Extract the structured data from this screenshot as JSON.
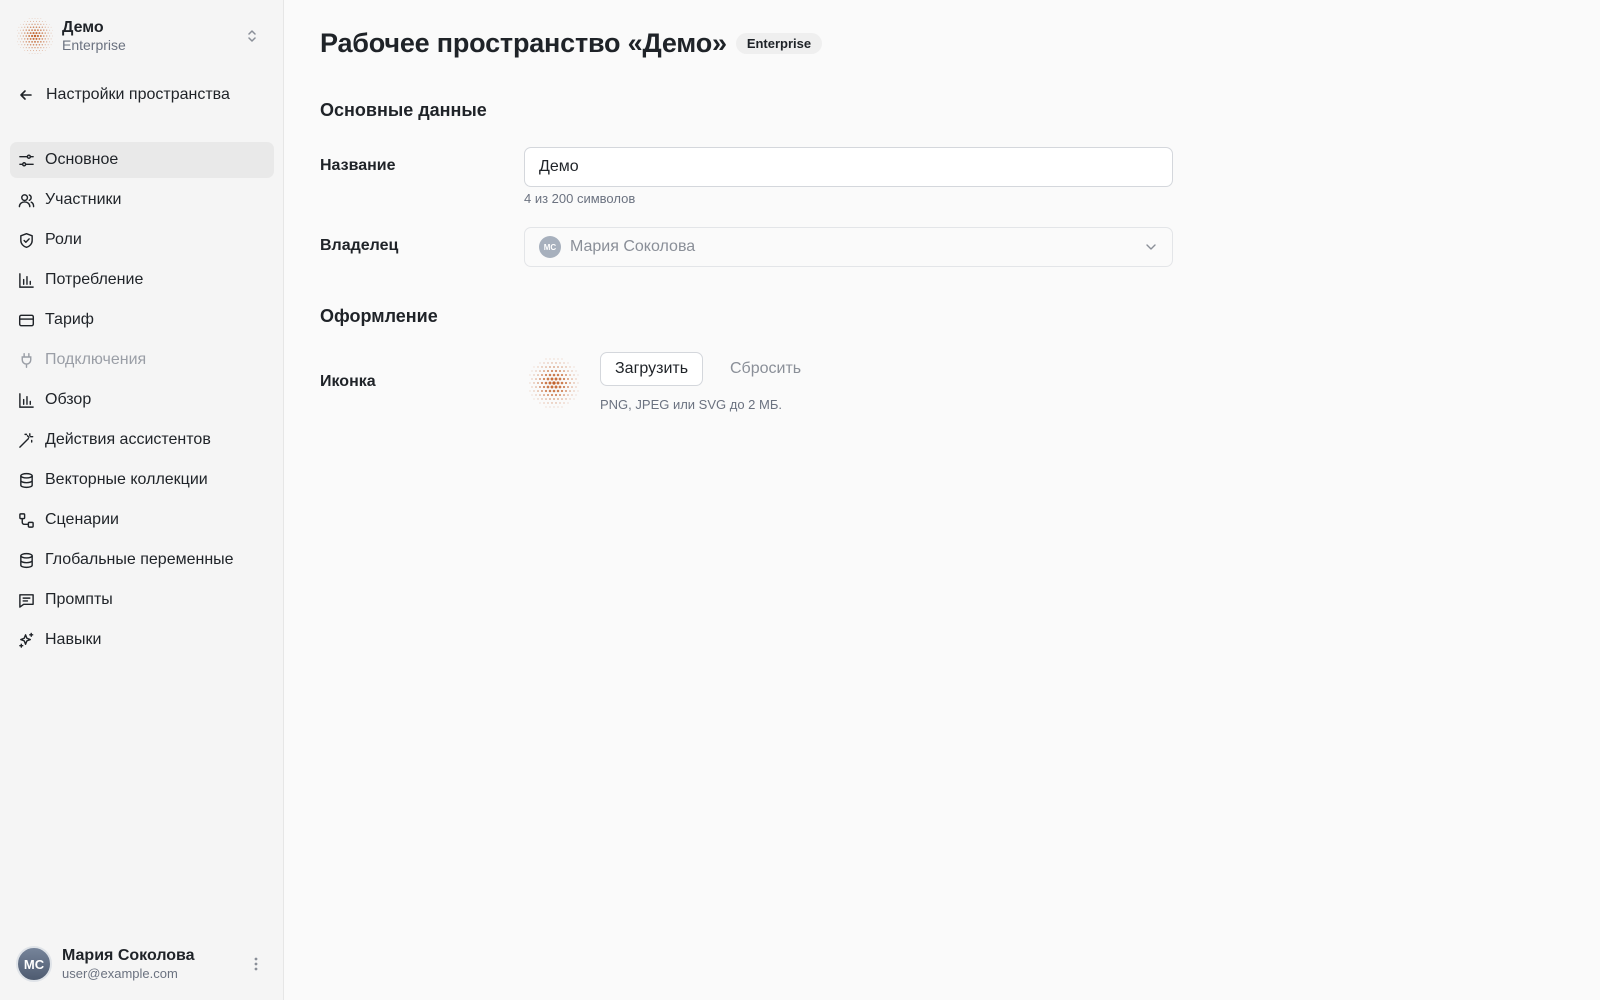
{
  "workspace": {
    "name": "Демо",
    "plan": "Enterprise"
  },
  "sidebar": {
    "back_label": "Настройки пространства",
    "items": [
      {
        "label": "Основное",
        "icon": "sliders-icon",
        "active": true
      },
      {
        "label": "Участники",
        "icon": "users-icon"
      },
      {
        "label": "Роли",
        "icon": "shield-icon"
      },
      {
        "label": "Потребление",
        "icon": "bar-chart-icon"
      },
      {
        "label": "Тариф",
        "icon": "credit-card-icon"
      },
      {
        "label": "Подключения",
        "icon": "plug-icon",
        "disabled": true
      },
      {
        "label": "Обзор",
        "icon": "bar-chart-icon"
      },
      {
        "label": "Действия ассистентов",
        "icon": "magic-wand-icon"
      },
      {
        "label": "Векторные коллекции",
        "icon": "database-icon"
      },
      {
        "label": "Сценарии",
        "icon": "workflow-icon"
      },
      {
        "label": "Глобальные переменные",
        "icon": "database-icon"
      },
      {
        "label": "Промпты",
        "icon": "message-icon"
      },
      {
        "label": "Навыки",
        "icon": "sparkles-icon"
      }
    ]
  },
  "user": {
    "initials": "МС",
    "name": "Мария Соколова",
    "email": "user@example.com"
  },
  "main": {
    "title": "Рабочее пространство «Демо»",
    "plan_badge": "Enterprise",
    "basic_section": "Основные данные",
    "name_label": "Название",
    "name_value": "Демо",
    "name_counter": "4 из 200 символов",
    "owner_label": "Владелец",
    "owner_initials": "МС",
    "owner_name": "Мария Соколова",
    "design_section": "Оформление",
    "icon_label": "Иконка",
    "upload_label": "Загрузить",
    "reset_label": "Сбросить",
    "icon_hint": "PNG, JPEG или SVG до 2 МБ."
  },
  "colors": {
    "accent": "#c2612a",
    "sidebar_bg": "#f5f5f5",
    "page_bg": "#fafafa"
  }
}
